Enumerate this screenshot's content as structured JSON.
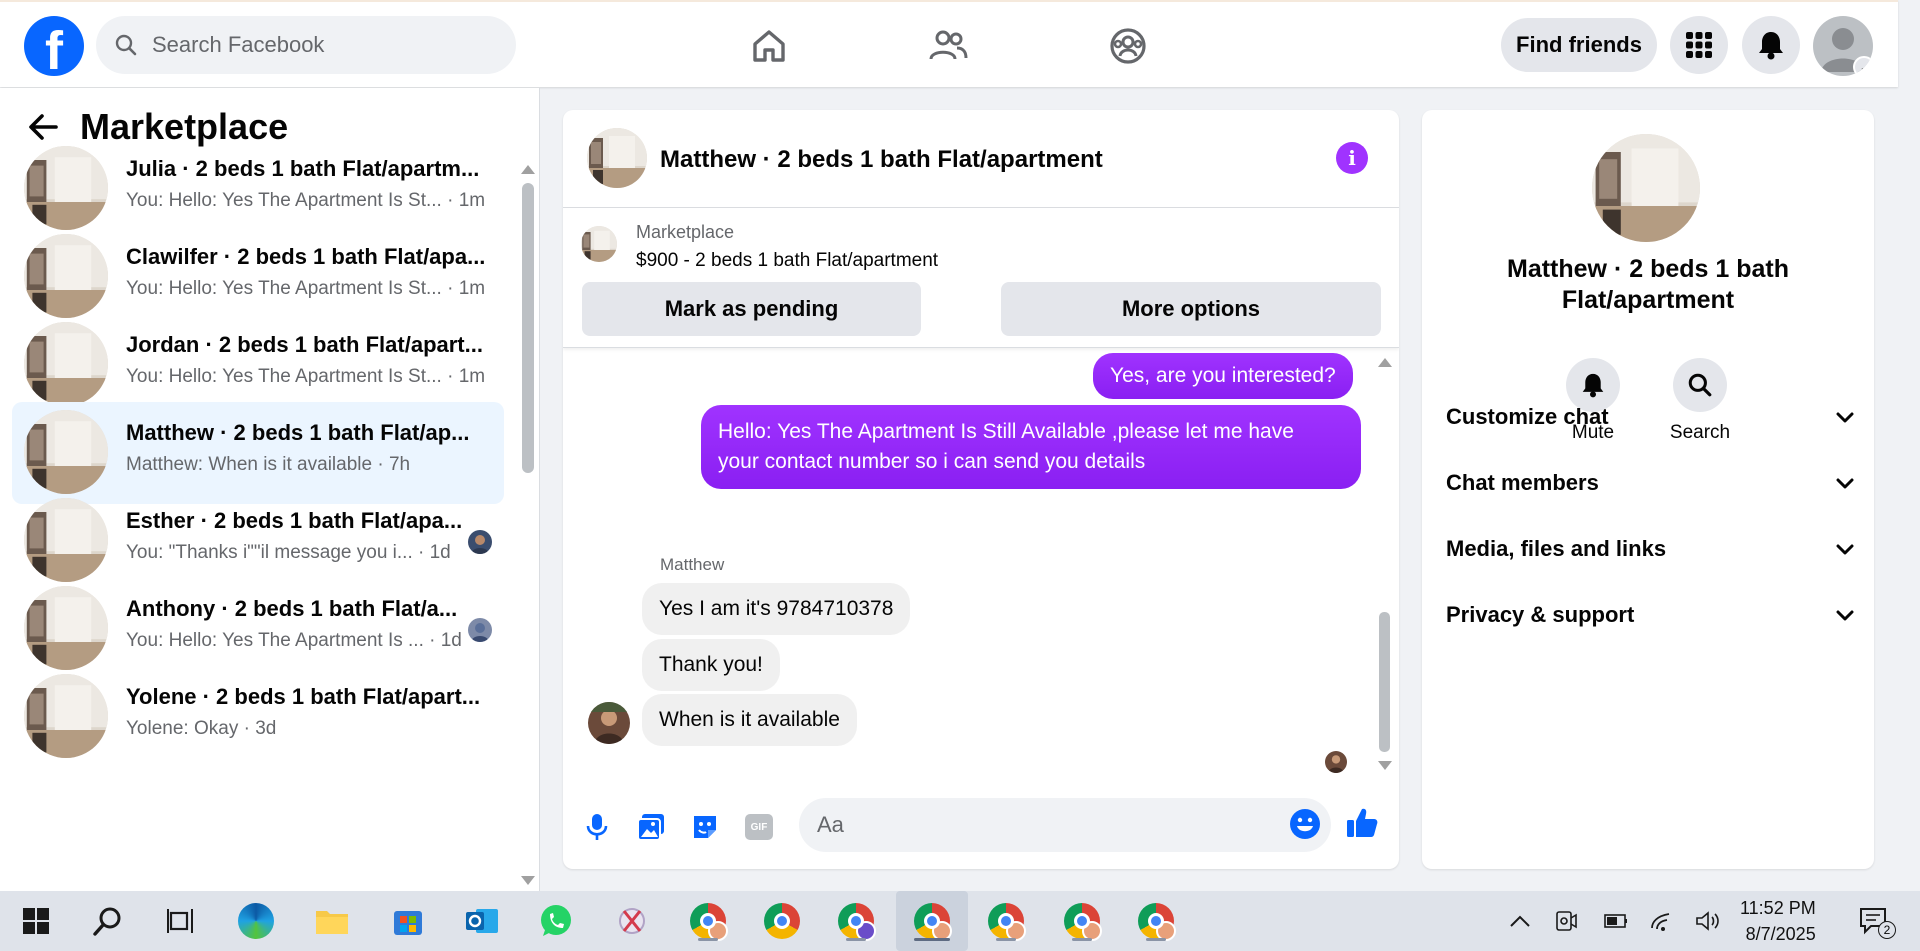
{
  "topbar": {
    "logo_letter": "f",
    "search_placeholder": "Search Facebook",
    "find_friends_label": "Find friends"
  },
  "sidebar": {
    "title": "Marketplace",
    "conversations": [
      {
        "name": "Julia · 2 beds 1 bath Flat/apartm...",
        "snippet": "You: Hello: Yes The Apartment Is St... · 1m",
        "active": false
      },
      {
        "name": "Clawilfer · 2 beds 1 bath Flat/apa...",
        "snippet": "You: Hello: Yes The Apartment Is St... · 1m",
        "active": false
      },
      {
        "name": "Jordan · 2 beds 1 bath Flat/apart...",
        "snippet": "You: Hello: Yes The Apartment Is St... · 1m",
        "active": false
      },
      {
        "name": "Matthew · 2 beds 1 bath Flat/ap...",
        "snippet": "Matthew: When is it available · 7h",
        "active": true
      },
      {
        "name": "Esther · 2 beds 1 bath Flat/apa...",
        "snippet": "You: \"Thanks i\"\"il message you i... · 1d",
        "active": false
      },
      {
        "name": "Anthony · 2 beds 1 bath Flat/a...",
        "snippet": "You: Hello: Yes The Apartment Is ... · 1d",
        "active": false
      },
      {
        "name": "Yolene · 2 beds 1 bath Flat/apart...",
        "snippet": "Yolene: Okay · 3d",
        "active": false
      }
    ]
  },
  "chat": {
    "title": "Matthew · 2 beds 1 bath Flat/apartment",
    "marketplace_label": "Marketplace",
    "listing": "$900 - 2 beds 1 bath Flat/apartment",
    "mark_pending_label": "Mark as pending",
    "more_options_label": "More options",
    "messages_out": [
      "Yes, are you interested?",
      "Hello: Yes The Apartment Is Still Available ,please let me have",
      "your contact number so i can send you details"
    ],
    "sender_name": "Matthew",
    "messages_in": [
      "Yes I am it's 9784710378",
      "Thank you!",
      "When is it available"
    ],
    "composer_placeholder": "Aa",
    "gif_label": "GIF"
  },
  "info_panel": {
    "title": "Matthew · 2 beds 1 bath Flat/apartment",
    "mute_label": "Mute",
    "search_label": "Search",
    "sections": [
      "Customize chat",
      "Chat members",
      "Media, files and links",
      "Privacy & support"
    ]
  },
  "taskbar": {
    "time": "11:52 PM",
    "date": "8/7/2025",
    "notification_count": "2"
  },
  "colors": {
    "facebook_blue": "#0866ff",
    "messenger_purple": "#a033ff",
    "active_row": "#ebf5ff"
  }
}
